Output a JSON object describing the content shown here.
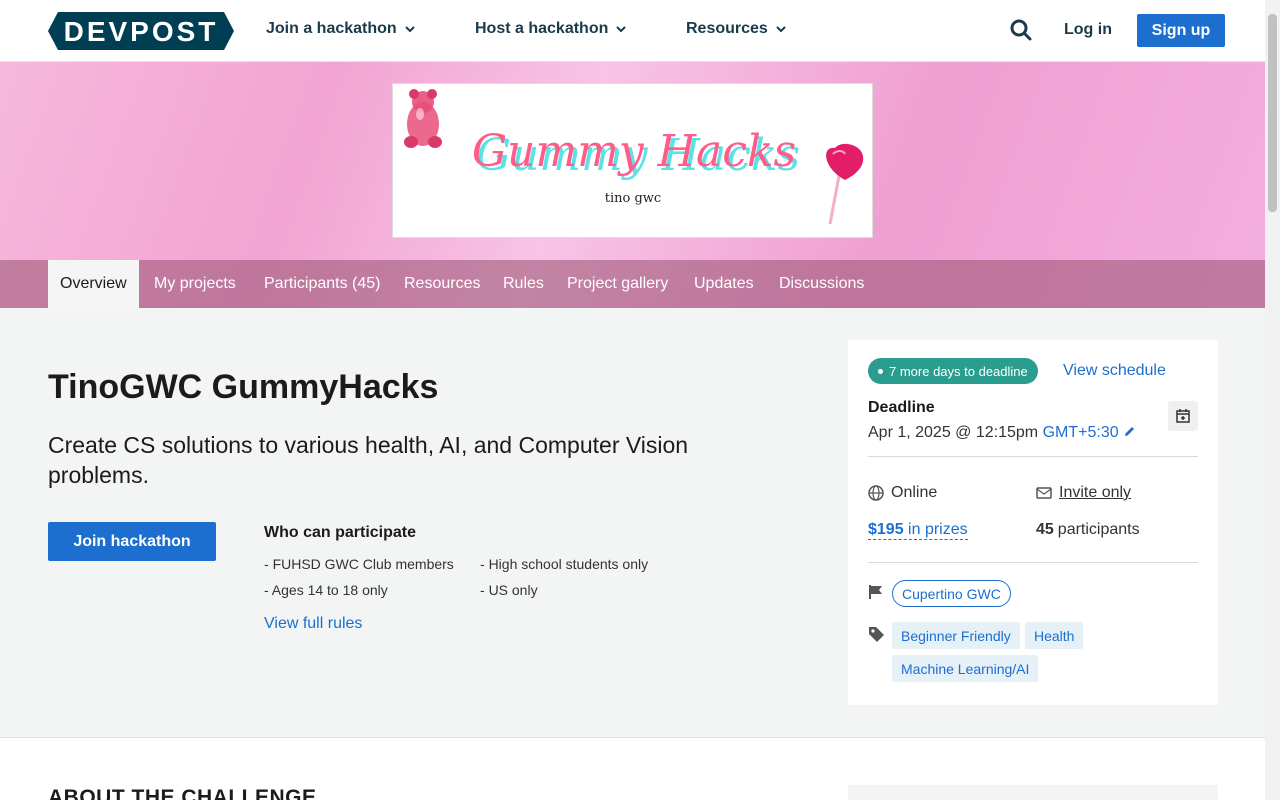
{
  "header": {
    "logo_text": "DEVPOST",
    "nav": [
      {
        "label": "Join a hackathon"
      },
      {
        "label": "Host a hackathon"
      },
      {
        "label": "Resources"
      }
    ],
    "login_label": "Log in",
    "signup_label": "Sign up"
  },
  "banner": {
    "title_art": "Gummy Hacks",
    "subtitle_art": "tino gwc"
  },
  "tabs": [
    {
      "label": "Overview"
    },
    {
      "label": "My projects"
    },
    {
      "label": "Participants (45)"
    },
    {
      "label": "Resources"
    },
    {
      "label": "Rules"
    },
    {
      "label": "Project gallery"
    },
    {
      "label": "Updates"
    },
    {
      "label": "Discussions"
    }
  ],
  "hackathon": {
    "title": "TinoGWC GummyHacks",
    "tagline": "Create CS solutions to various health, AI, and Computer Vision problems.",
    "join_label": "Join hackathon",
    "who_title": "Who can participate",
    "criteria": [
      "FUHSD GWC Club members",
      "High school students only",
      "Ages 14 to 18 only",
      "US only"
    ],
    "rules_link": "View full rules"
  },
  "sidebar": {
    "deadline_pill": "7 more days to deadline",
    "view_schedule": "View schedule",
    "deadline_label": "Deadline",
    "deadline_date": "Apr 1, 2025 @ 12:15pm",
    "timezone": "GMT+5:30",
    "location": "Online",
    "access": "Invite only",
    "prize_amount": "$195",
    "prize_suffix": "in prizes",
    "participants_count": "45",
    "participants_suffix": "participants",
    "organizer": "Cupertino GWC",
    "tags": [
      "Beginner Friendly",
      "Health",
      "Machine Learning/AI"
    ]
  },
  "about": {
    "heading": "ABOUT THE CHALLENGE"
  },
  "colors": {
    "brand_blue": "#1c6fcf",
    "navy": "#1b3a4b",
    "teal": "#2a9d8f"
  }
}
